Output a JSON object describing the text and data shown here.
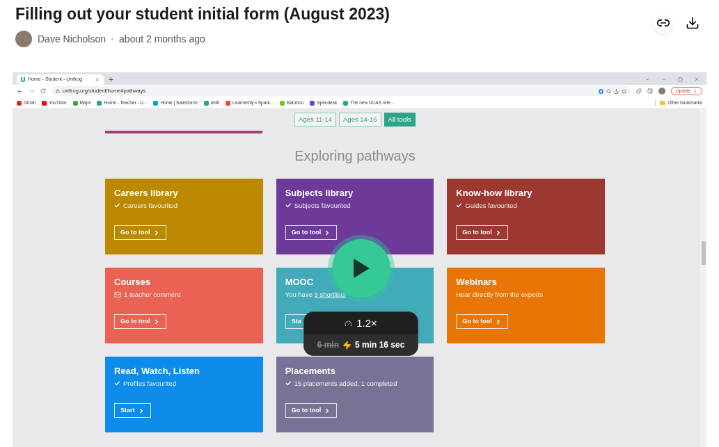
{
  "title": "Filling out your student initial form (August 2023)",
  "author": {
    "name": "Dave Nicholson",
    "time": "about 2 months ago"
  },
  "browser": {
    "tab_title": "Home - Student - Unifrog",
    "url": "unifrog.org/student/home#pathways",
    "update_button": "Update",
    "bookmarks": [
      {
        "label": "Gmail",
        "color": "#d93025"
      },
      {
        "label": "YouTube",
        "color": "#ff0000"
      },
      {
        "label": "Maps",
        "color": "#34a853"
      },
      {
        "label": "Home - Teacher - U...",
        "color": "#2aa58a"
      },
      {
        "label": "Home | Salesforce",
        "color": "#00a1e0"
      },
      {
        "label": "/edit",
        "color": "#2aa58a"
      },
      {
        "label": "Learnerbly • Spark...",
        "color": "#e8453c"
      },
      {
        "label": "Bamboo",
        "color": "#73c41d"
      },
      {
        "label": "Spendesk",
        "color": "#6c3fe0"
      },
      {
        "label": "The new UCAS refe...",
        "color": "#2aa58a"
      }
    ],
    "other_bookmarks": "Other bookmarks"
  },
  "page": {
    "age_tabs": [
      {
        "label": "Ages 11-14",
        "selected": false
      },
      {
        "label": "Ages 14-16",
        "selected": false
      },
      {
        "label": "All tools",
        "selected": true
      }
    ],
    "heading": "Exploring pathways",
    "cards": [
      {
        "title": "Careers library",
        "kind": "favourited",
        "note": "Careers favourited",
        "button": "Go to tool",
        "color": "#bb8800"
      },
      {
        "title": "Subjects library",
        "kind": "favourited",
        "note": "Subjects favourited",
        "button": "Go to tool",
        "color": "#6e3a9a"
      },
      {
        "title": "Know-how library",
        "kind": "favourited",
        "note": "Guides favourited",
        "button": "Go to tool",
        "color": "#9c3830"
      },
      {
        "title": "Courses",
        "kind": "comment",
        "note": "1 teacher comment",
        "button": "Go to tool",
        "color": "#e96254"
      },
      {
        "title": "MOOC",
        "kind": "plain",
        "note": "You have",
        "note_link": "3 shortlists",
        "button": "Sta",
        "color": "#42aab8"
      },
      {
        "title": "Webinars",
        "kind": "plain",
        "note": "Hear directly from the experts",
        "button": "Go to tool",
        "color": "#ea7507"
      },
      {
        "title": "Read, Watch, Listen",
        "kind": "favourited",
        "note": "Profiles favourited",
        "button": "Start",
        "color": "#0d8ce9"
      },
      {
        "title": "Placements",
        "kind": "favourited",
        "note": "15 placements added, 1 completed",
        "button": "Go to tool",
        "color": "#797295"
      }
    ]
  },
  "speed": {
    "rate": "1.2×",
    "original": "6 min",
    "shortened": "5 min 16 sec"
  }
}
